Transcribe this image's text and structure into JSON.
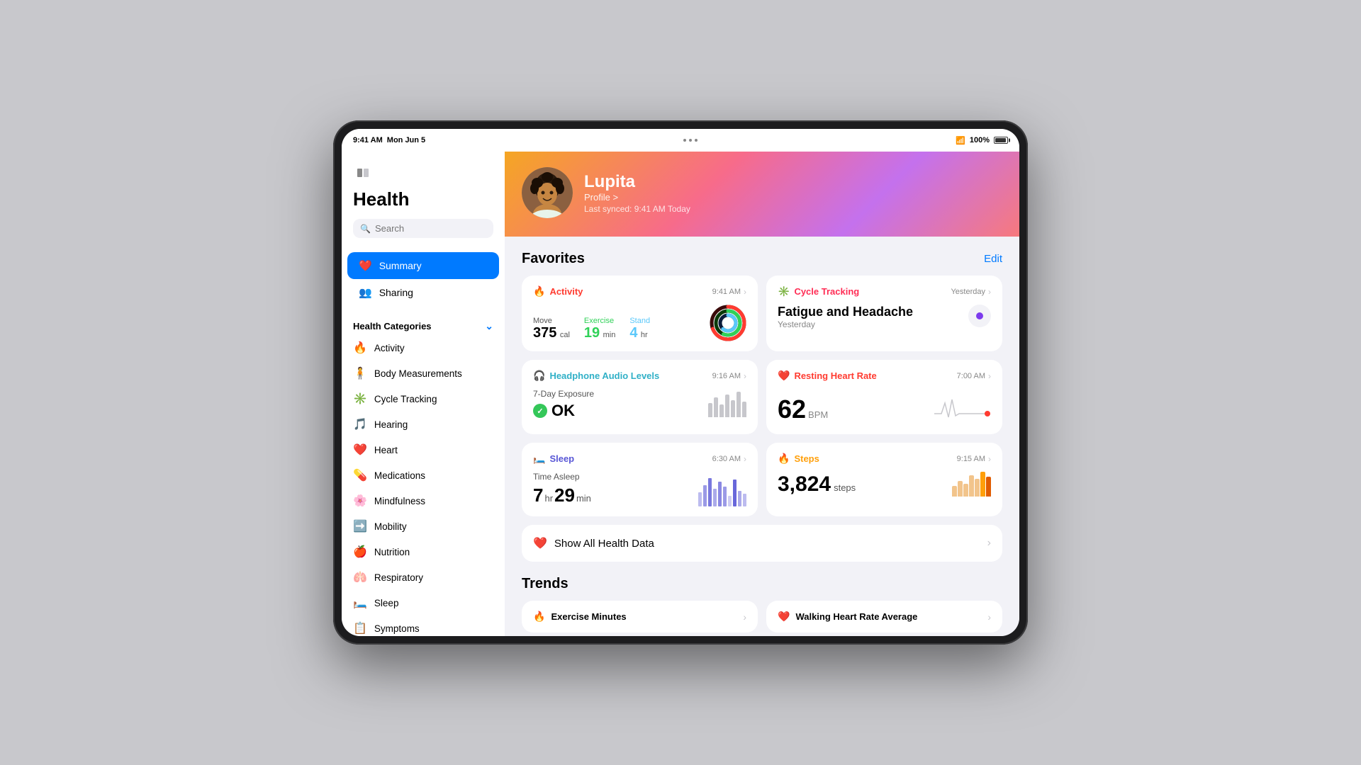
{
  "statusBar": {
    "time": "9:41 AM",
    "date": "Mon Jun 5",
    "battery": "100%"
  },
  "sidebar": {
    "title": "Health",
    "search": {
      "placeholder": "Search"
    },
    "navItems": [
      {
        "id": "summary",
        "label": "Summary",
        "icon": "❤️",
        "active": true
      },
      {
        "id": "sharing",
        "label": "Sharing",
        "icon": "👥",
        "active": false
      }
    ],
    "categoriesHeader": "Health Categories",
    "categories": [
      {
        "id": "activity",
        "label": "Activity",
        "icon": "🔥"
      },
      {
        "id": "body",
        "label": "Body Measurements",
        "icon": "🧍"
      },
      {
        "id": "cycle",
        "label": "Cycle Tracking",
        "icon": "✳️"
      },
      {
        "id": "hearing",
        "label": "Hearing",
        "icon": "🎵"
      },
      {
        "id": "heart",
        "label": "Heart",
        "icon": "❤️"
      },
      {
        "id": "medications",
        "label": "Medications",
        "icon": "💊"
      },
      {
        "id": "mindfulness",
        "label": "Mindfulness",
        "icon": "🌸"
      },
      {
        "id": "mobility",
        "label": "Mobility",
        "icon": "➡️"
      },
      {
        "id": "nutrition",
        "label": "Nutrition",
        "icon": "🍎"
      },
      {
        "id": "respiratory",
        "label": "Respiratory",
        "icon": "🫁"
      },
      {
        "id": "sleep",
        "label": "Sleep",
        "icon": "🛏️"
      },
      {
        "id": "symptoms",
        "label": "Symptoms",
        "icon": "📋"
      }
    ]
  },
  "profile": {
    "name": "Lupita",
    "profileLink": "Profile >",
    "lastSynced": "Last synced: 9:41 AM Today"
  },
  "favorites": {
    "title": "Favorites",
    "editLabel": "Edit",
    "cards": {
      "activity": {
        "title": "Activity",
        "time": "9:41 AM",
        "move": {
          "label": "Move",
          "value": "375",
          "unit": "cal"
        },
        "exercise": {
          "label": "Exercise",
          "value": "19",
          "unit": "min"
        },
        "stand": {
          "label": "Stand",
          "value": "4",
          "unit": "hr"
        }
      },
      "cycleTracking": {
        "title": "Cycle Tracking",
        "time": "Yesterday",
        "symptom": "Fatigue and Headache",
        "symptomDate": "Yesterday"
      },
      "headphone": {
        "title": "Headphone Audio Levels",
        "time": "9:16 AM",
        "exposureLabel": "7-Day Exposure",
        "status": "OK"
      },
      "restingHeart": {
        "title": "Resting Heart Rate",
        "time": "7:00 AM",
        "value": "62",
        "unit": "BPM"
      },
      "sleep": {
        "title": "Sleep",
        "time": "6:30 AM",
        "label": "Time Asleep",
        "hours": "7",
        "minutes": "29"
      },
      "steps": {
        "title": "Steps",
        "time": "9:15 AM",
        "value": "3,824",
        "unit": "steps"
      }
    },
    "showAllLabel": "Show All Health Data"
  },
  "trends": {
    "title": "Trends",
    "items": [
      {
        "label": "Exercise Minutes",
        "icon": "🔥"
      },
      {
        "label": "Walking Heart Rate Average",
        "icon": "❤️"
      }
    ]
  }
}
